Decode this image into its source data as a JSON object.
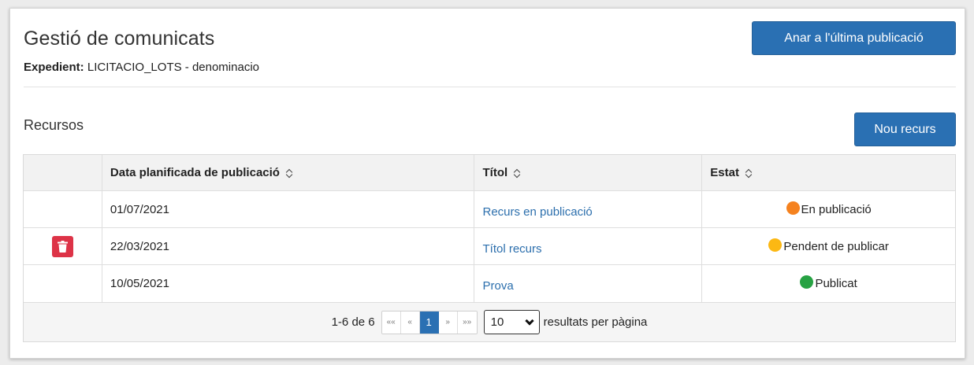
{
  "header": {
    "title": "Gestió de comunicats",
    "expedient_label": "Expedient:",
    "expedient_value": "LICITACIO_LOTS - denominacio",
    "last_pub_button": "Anar a l'última publicació"
  },
  "section": {
    "title": "Recursos",
    "new_button": "Nou recurs"
  },
  "table": {
    "columns": [
      "",
      "Data planificada de publicació",
      "Títol",
      "Estat"
    ],
    "rows": [
      {
        "date": "01/07/2021",
        "title": "Recurs en publicació",
        "status": "En publicació",
        "status_color": "#f5821f",
        "deletable": false
      },
      {
        "date": "22/03/2021",
        "title": "Títol recurs",
        "status": "Pendent de publicar",
        "status_color": "#fcb813",
        "deletable": true
      },
      {
        "date": "10/05/2021",
        "title": "Prova",
        "status": "Publicat",
        "status_color": "#27a243",
        "deletable": false
      }
    ]
  },
  "pagination": {
    "range": "1-6 de 6",
    "first": "««",
    "prev": "«",
    "current": "1",
    "next": "»",
    "last": "»»",
    "page_size": "10",
    "per_page_label": "resultats per pàgina"
  },
  "colors": {
    "primary": "#2a70b3",
    "danger": "#dd3347",
    "link": "#2c6fad"
  },
  "icons": {
    "delete": "trash-icon",
    "sort": "sort-icon",
    "dropdown": "chevron-down-icon"
  }
}
